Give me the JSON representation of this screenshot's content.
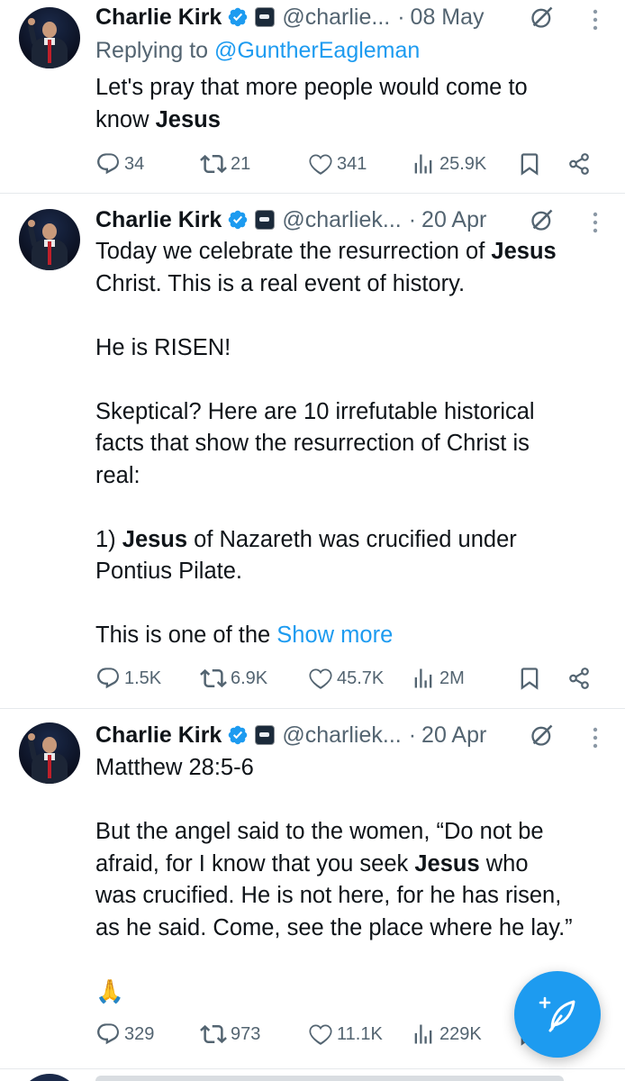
{
  "tweets": [
    {
      "author": "Charlie Kirk",
      "handle": "@charlie...",
      "dot": "·",
      "date": "08 May",
      "replying_prefix": "Replying to",
      "replying_to": "@GuntherEagleman",
      "lines": [
        {
          "before": "Let's pray that more people would come to",
          "bold": "",
          "after": ""
        },
        {
          "before": "know ",
          "bold": "Jesus",
          "after": ""
        }
      ],
      "stats": {
        "replies": "34",
        "reposts": "21",
        "likes": "341",
        "views": "25.9K"
      }
    },
    {
      "author": "Charlie Kirk",
      "handle": "@charliek...",
      "dot": "·",
      "date": "20 Apr",
      "lines": [
        {
          "before": "Today we celebrate the resurrection of ",
          "bold": "Jesus",
          "after": ""
        },
        {
          "before": "Christ. This is a real event of history.",
          "bold": "",
          "after": ""
        },
        {
          "before": "",
          "bold": "",
          "after": ""
        },
        {
          "before": "He is RISEN!",
          "bold": "",
          "after": ""
        },
        {
          "before": "",
          "bold": "",
          "after": ""
        },
        {
          "before": "Skeptical? Here are 10 irrefutable historical",
          "bold": "",
          "after": ""
        },
        {
          "before": "facts that show the resurrection of Christ is",
          "bold": "",
          "after": ""
        },
        {
          "before": "real:",
          "bold": "",
          "after": ""
        },
        {
          "before": "",
          "bold": "",
          "after": ""
        },
        {
          "before": "1) ",
          "bold": "Jesus",
          "after": " of Nazareth was crucified under"
        },
        {
          "before": "Pontius Pilate.",
          "bold": "",
          "after": ""
        },
        {
          "before": "",
          "bold": "",
          "after": ""
        },
        {
          "before": "This is one of the ",
          "bold": "",
          "after": ""
        }
      ],
      "show_more": "Show more",
      "stats": {
        "replies": "1.5K",
        "reposts": "6.9K",
        "likes": "45.7K",
        "views": "2M"
      }
    },
    {
      "author": "Charlie Kirk",
      "handle": "@charliek...",
      "dot": "·",
      "date": "20 Apr",
      "lines": [
        {
          "before": "Matthew 28:5-6",
          "bold": "",
          "after": ""
        },
        {
          "before": "",
          "bold": "",
          "after": ""
        },
        {
          "before": "But the angel said to the women, “Do not be",
          "bold": "",
          "after": ""
        },
        {
          "before": "afraid, for I know that you seek ",
          "bold": "Jesus",
          "after": " who"
        },
        {
          "before": "was crucified. He is not here, for he has risen,",
          "bold": "",
          "after": ""
        },
        {
          "before": "as he said. Come, see the place where he lay.”",
          "bold": "",
          "after": ""
        },
        {
          "before": "",
          "bold": "",
          "after": ""
        },
        {
          "before": "🙏",
          "bold": "",
          "after": ""
        }
      ],
      "stats": {
        "replies": "329",
        "reposts": "973",
        "likes": "11.1K",
        "views": "229K"
      }
    }
  ],
  "icons": {
    "reply": "reply-icon",
    "repost": "repost-icon",
    "like": "heart-icon",
    "views": "views-icon",
    "bookmark": "bookmark-icon",
    "share": "share-icon",
    "grok": "grok-icon",
    "more": "more-options-icon",
    "verified": "verified-badge-icon",
    "compose": "compose-post-icon"
  },
  "colors": {
    "accent": "#1d9bf0",
    "muted": "#536471",
    "text": "#0f1419"
  }
}
